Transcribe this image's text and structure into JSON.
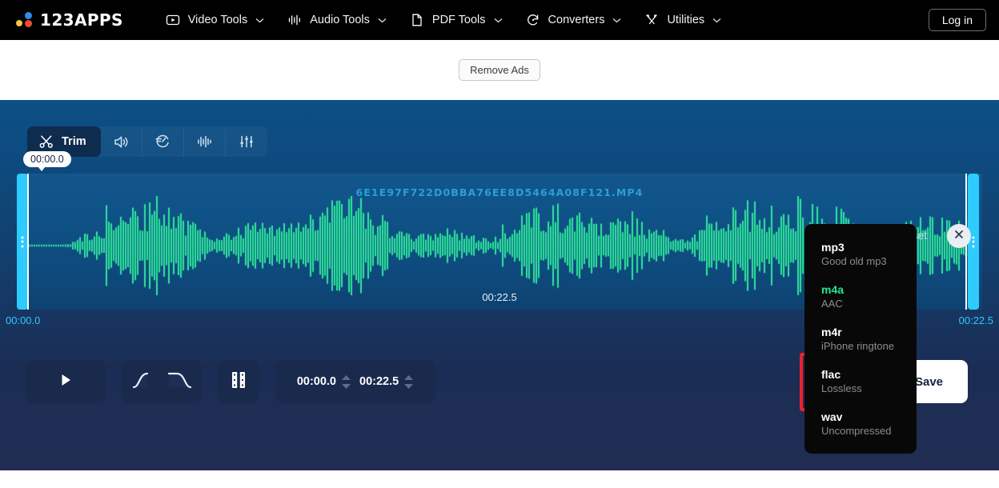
{
  "nav": {
    "logo_text": "123APPS",
    "items": [
      {
        "label": "Video Tools",
        "icon": "video-icon"
      },
      {
        "label": "Audio Tools",
        "icon": "audio-wave-icon"
      },
      {
        "label": "PDF Tools",
        "icon": "document-icon"
      },
      {
        "label": "Converters",
        "icon": "convert-refresh-icon"
      },
      {
        "label": "Utilities",
        "icon": "tools-cross-icon"
      }
    ],
    "login_label": "Log in"
  },
  "ads": {
    "remove_ads_label": "Remove Ads"
  },
  "editor": {
    "toolbar": {
      "trim_label": "Trim",
      "tools": [
        {
          "name": "trim",
          "icon": "scissors-icon"
        },
        {
          "name": "volume",
          "icon": "speaker-icon"
        },
        {
          "name": "speed",
          "icon": "speed-timer-icon"
        },
        {
          "name": "waveform",
          "icon": "waveform-icon"
        },
        {
          "name": "equalizer",
          "icon": "equalizer-icon"
        }
      ]
    },
    "reset_label": "Reset",
    "file_name": "6E1E97F722D0BBA76EE8D5464A08F121.MP4",
    "duration_center": "00:22.5",
    "handle_tooltip": "00:00.0",
    "time_start": "00:00.0",
    "time_end": "00:22.5",
    "controls": {
      "start_value": "00:00.0",
      "end_value": "00:22.5",
      "format_label": "m4a",
      "save_label": "Save"
    }
  },
  "dropdown": {
    "options": [
      {
        "title": "mp3",
        "subtitle": "Good old mp3",
        "selected": false
      },
      {
        "title": "m4a",
        "subtitle": "AAC",
        "selected": true
      },
      {
        "title": "m4r",
        "subtitle": "iPhone ringtone",
        "selected": false
      },
      {
        "title": "flac",
        "subtitle": "Lossless",
        "selected": false
      },
      {
        "title": "wav",
        "subtitle": "Uncompressed",
        "selected": false
      }
    ]
  },
  "colors": {
    "waveform": "#2EE89A",
    "handle": "#2ECBFF",
    "accent_green": "#1EE792",
    "highlight_red": "#EE2128",
    "panel_top": "#0C5086",
    "panel_bottom": "#212D53"
  }
}
